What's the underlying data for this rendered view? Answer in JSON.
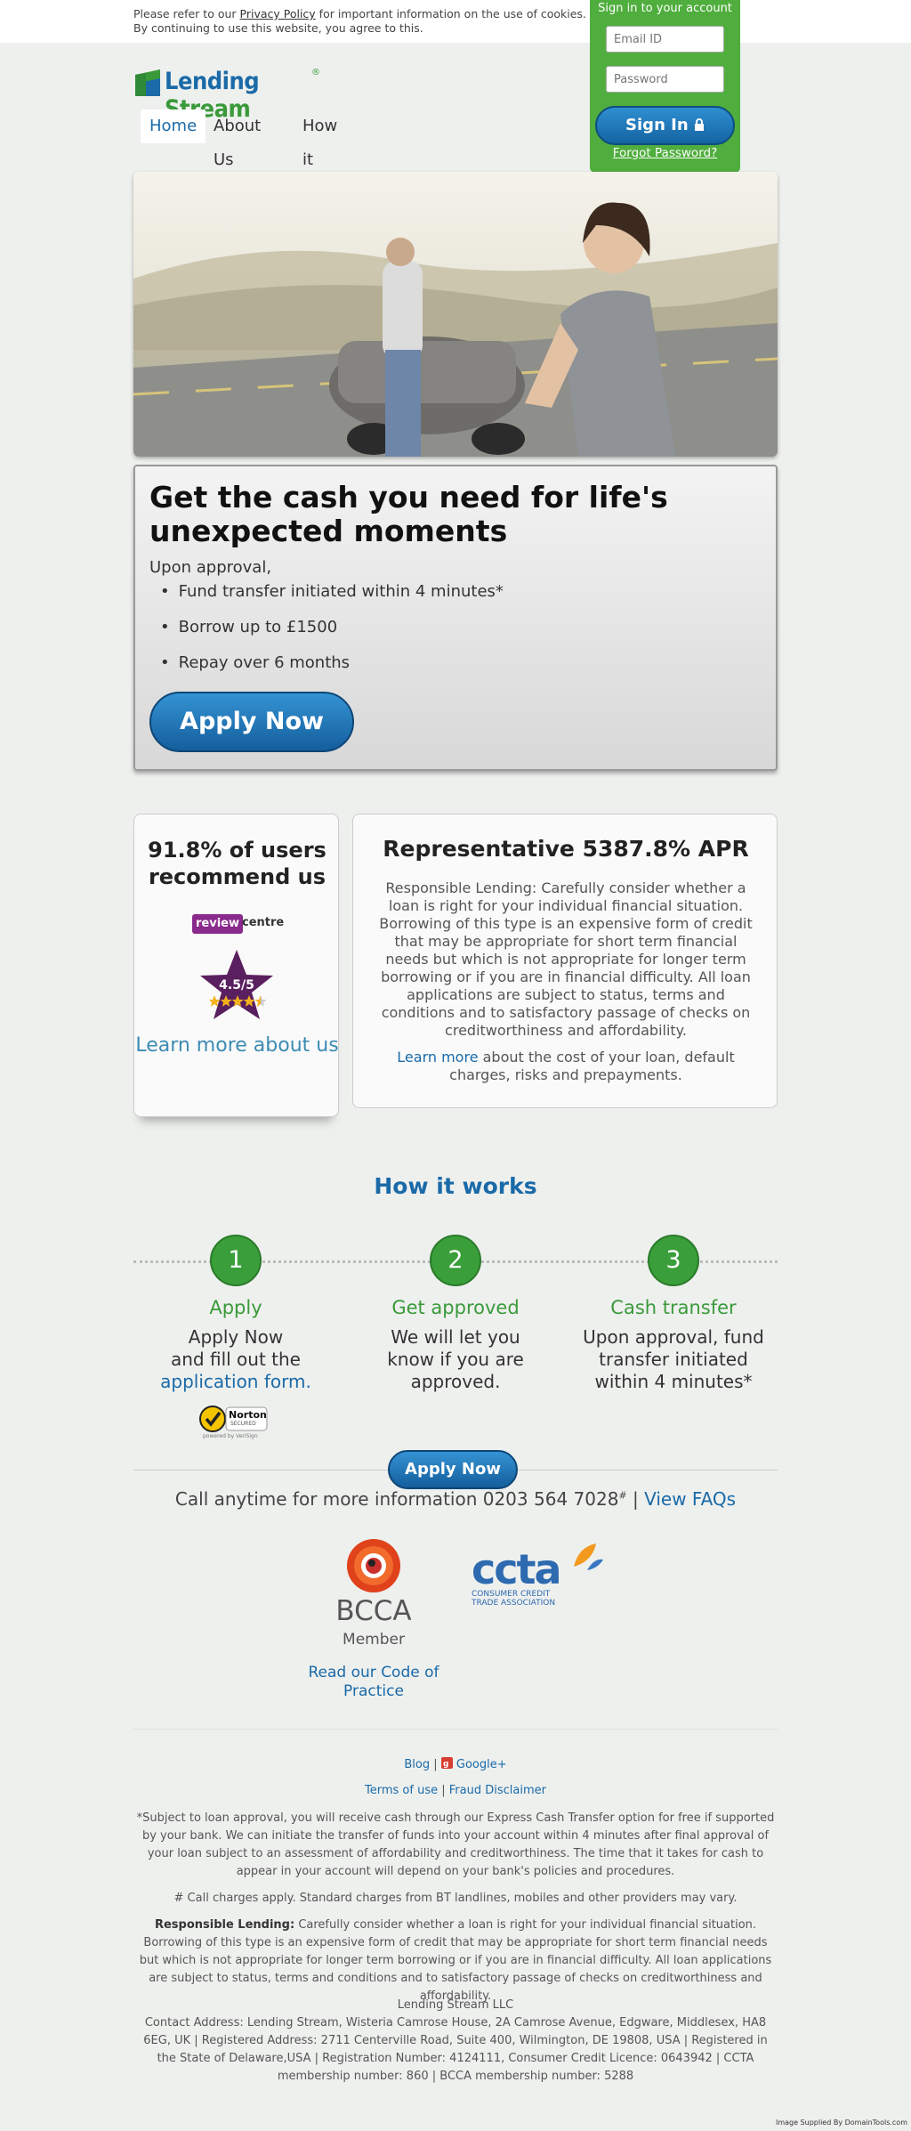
{
  "cookie": {
    "before": "Please refer to our ",
    "link": "Privacy Policy",
    "after": " for important information on the use of cookies. By continuing to use this website, you agree to this."
  },
  "signin": {
    "title": "Sign in to your account",
    "email_placeholder": "Email ID",
    "password_placeholder": "Password",
    "button": "Sign In",
    "button_icon": "lock-icon",
    "forgot": "Forgot Password?"
  },
  "logo": {
    "word1": "Lending",
    "word2": "Stream",
    "reg": "®"
  },
  "nav": [
    {
      "label": "Home",
      "active": true
    },
    {
      "label": "About Us",
      "active": false
    },
    {
      "label": "How it Works",
      "active": false
    }
  ],
  "promo": {
    "title": "Get the cash you need for life's unexpected moments",
    "sub": "Upon approval,",
    "bullets": [
      "Fund transfer initiated within 4 minutes*",
      "Borrow up to £1500",
      "Repay over 6 months"
    ],
    "apply": "Apply Now"
  },
  "recommend": {
    "stat": "91.8% of users recommend us",
    "rc_review": "review",
    "rc_centre": "centre",
    "rating": "4.5/5",
    "stars": 4.5,
    "learn": "Learn more about us"
  },
  "apr": {
    "title": "Representative 5387.8% APR",
    "text": "Responsible Lending: Carefully consider whether a loan is right for your individual financial situation. Borrowing of this type is an expensive form of credit that may be appropriate for short term financial needs but which is not appropriate for longer term borrowing or if you are in financial difficulty. All loan applications are subject to status, terms and conditions and to satisfactory passage of checks on creditworthiness and affordability.",
    "learn_link": "Learn more",
    "learn_rest": " about the cost of your loan, default charges, risks and prepayments."
  },
  "how": {
    "title": "How it works",
    "steps": [
      {
        "num": "1",
        "heading": "Apply",
        "line1": "Apply Now",
        "line2": "and fill out the",
        "link": "application form."
      },
      {
        "num": "2",
        "heading": "Get approved",
        "text": "We will let you know if you are approved."
      },
      {
        "num": "3",
        "heading": "Cash transfer",
        "text": "Upon approval, fund transfer initiated within 4 minutes*"
      }
    ]
  },
  "norton": {
    "brand": "Norton",
    "secured": "SECURED",
    "powered": "powered by VeriSign"
  },
  "apply_small": "Apply Now",
  "call": {
    "text": "Call anytime for more information 0203 564 7028",
    "sup": "#",
    "sep": " | ",
    "faq": "View FAQs"
  },
  "bcca": {
    "name": "BCCA",
    "member": "Member",
    "code": "Read our Code of Practice"
  },
  "ccta": {
    "name": "ccta",
    "tagline1": "CONSUMER CREDIT",
    "tagline2": "TRADE ASSOCIATION"
  },
  "footer": {
    "blog": "Blog",
    "sep": " | ",
    "gplus": "Google+",
    "terms": "Terms of use",
    "fraud": "Fraud Disclaimer",
    "note1": "*Subject to loan approval, you will receive cash through our Express Cash Transfer option for free if supported by your bank. We can initiate the transfer of funds into your account within 4 minutes after final approval of your loan subject to an assessment of affordability and creditworthiness. The time that it takes for cash to appear in your account will depend on your bank's policies and procedures.",
    "note2": "# Call charges apply. Standard charges from BT landlines, mobiles and other providers may vary.",
    "rl_label": "Responsible Lending:",
    "rl_text": " Carefully consider whether a loan is right for your individual financial situation. Borrowing of this type is an expensive form of credit that may be appropriate for short term financial needs but which is not appropriate for longer term borrowing or if you are in financial difficulty. All loan applications are subject to status, terms and conditions and to satisfactory passage of checks on creditworthiness and affordability.",
    "company": "Lending Stream LLC",
    "address": "Contact Address: Lending Stream, Wisteria Camrose House, 2A Camrose Avenue, Edgware, Middlesex, HA8 6EG, UK | Registered Address: 2711 Centerville Road, Suite 400, Wilmington, DE 19808, USA | Registered in the State of Delaware,USA | Registration Number: 4124111, Consumer Credit Licence: 0643942 | CCTA membership number: 860 | BCCA membership number: 5288"
  },
  "credit": "Image Supplied By DomainTools.com",
  "colors": {
    "brand_blue": "#1a6aa8",
    "brand_green": "#3a9a3a",
    "signin_bg": "#4fae3d"
  }
}
